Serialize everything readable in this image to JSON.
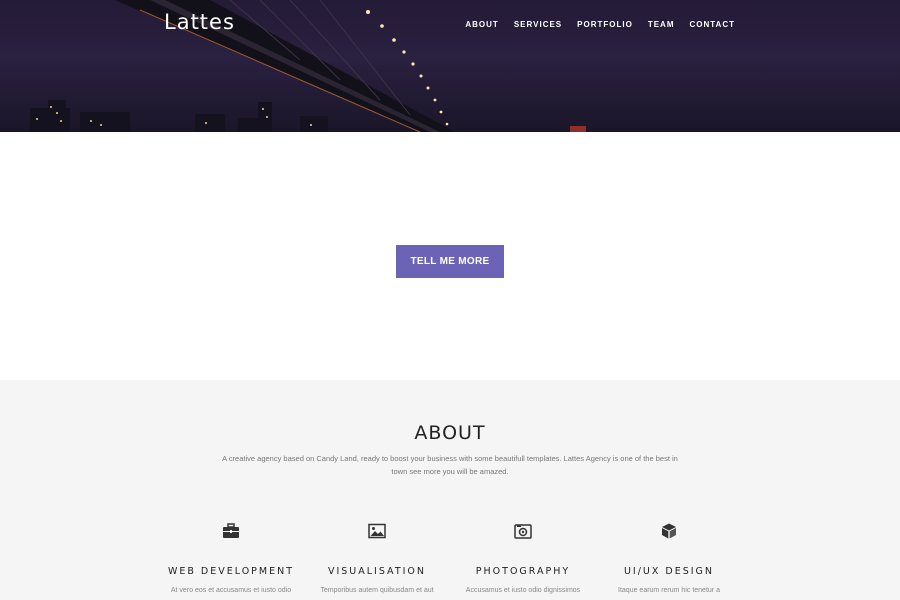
{
  "brand": {
    "logo": "Lattes"
  },
  "nav": {
    "items": [
      {
        "label": "ABOUT"
      },
      {
        "label": "SERVICES"
      },
      {
        "label": "PORTFOLIO"
      },
      {
        "label": "TEAM"
      },
      {
        "label": "CONTACT"
      }
    ]
  },
  "hero": {
    "cta_label": "TELL ME MORE"
  },
  "about": {
    "title": "ABOUT",
    "description": "A creative agency based on Candy Land, ready to boost your business with some beautifull templates. Lattes Agency is one of the best in town see more you will be amazed.",
    "services": [
      {
        "icon": "briefcase-icon",
        "title": "WEB DEVELOPMENT",
        "text": "At vero eos et accusamus et iusto odio"
      },
      {
        "icon": "picture-icon",
        "title": "VISUALISATION",
        "text": "Temporibus autem quibusdam et aut"
      },
      {
        "icon": "camera-icon",
        "title": "PHOTOGRAPHY",
        "text": "Accusamus et iusto odio dignissimos"
      },
      {
        "icon": "cube-icon",
        "title": "UI/UX DESIGN",
        "text": "Itaque earum rerum hic tenetur a"
      }
    ]
  },
  "colors": {
    "accent": "#6b63b5",
    "about_bg": "#f5f5f5",
    "hero_sky": "#241b37"
  }
}
